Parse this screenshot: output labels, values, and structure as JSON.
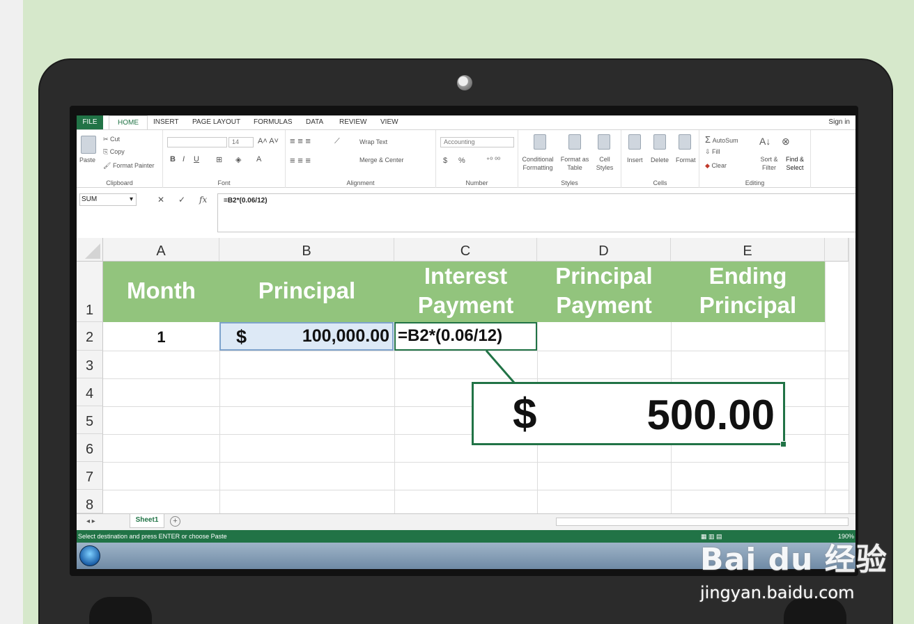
{
  "ribbon": {
    "tabs": [
      "FILE",
      "HOME",
      "INSERT",
      "PAGE LAYOUT",
      "FORMULAS",
      "DATA",
      "REVIEW",
      "VIEW"
    ],
    "sign_in": "Sign in",
    "clipboard": {
      "paste": "Paste",
      "cut": "Cut",
      "copy": "Copy",
      "format_painter": "Format Painter",
      "label": "Clipboard"
    },
    "font": {
      "size": "14",
      "label": "Font"
    },
    "alignment": {
      "wrap_text": "Wrap Text",
      "merge_center": "Merge & Center",
      "label": "Alignment"
    },
    "number": {
      "format": "Accounting",
      "currency": "$",
      "percent": "%",
      "label": "Number"
    },
    "styles": {
      "conditional": "Conditional Formatting",
      "format_table": "Format as Table",
      "cell_styles": "Cell Styles",
      "label": "Styles"
    },
    "cells": {
      "insert": "Insert",
      "delete": "Delete",
      "format": "Format",
      "label": "Cells"
    },
    "editing": {
      "autosum": "AutoSum",
      "fill": "Fill",
      "clear": "Clear",
      "sort_filter": "Sort & Filter",
      "find_select": "Find & Select",
      "label": "Editing"
    }
  },
  "formula_bar": {
    "name_box": "SUM",
    "formula": "=B2*(0.06/12)",
    "cancel": "✕",
    "enter": "✓",
    "fx": "fx"
  },
  "grid": {
    "columns": [
      "A",
      "B",
      "C",
      "D",
      "E"
    ],
    "rows": [
      "1",
      "2",
      "3",
      "4",
      "5",
      "6",
      "7",
      "8"
    ],
    "headers": {
      "a": "Month",
      "b": "Principal",
      "c1": "Interest",
      "c2": "Payment",
      "d1": "Principal",
      "d2": "Payment",
      "e1": "Ending",
      "e2": "Principal"
    },
    "row2": {
      "month": "1",
      "currency": "$",
      "principal": "100,000.00",
      "formula": "=B2*(0.06/12)"
    }
  },
  "callout": {
    "currency": "$",
    "value": "500.00"
  },
  "sheet": {
    "tab": "Sheet1",
    "add": "+"
  },
  "status": {
    "message": "Select destination and press ENTER or choose Paste",
    "zoom": "190%"
  },
  "watermark": {
    "brand": "Bai du 经验",
    "url": "jingyan.baidu.com"
  },
  "colors": {
    "excel_green": "#217346",
    "header_fill": "#92c47d",
    "background": "#d6e8cb"
  }
}
